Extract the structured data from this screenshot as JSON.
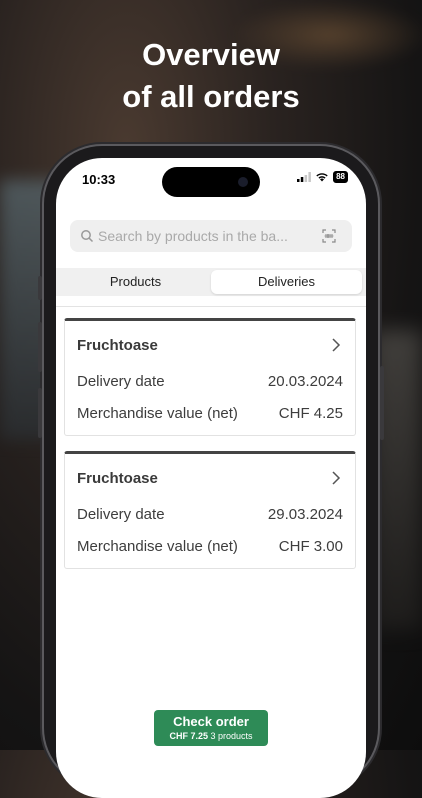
{
  "headline": {
    "line1": "Overview",
    "line2": "of all orders"
  },
  "status_bar": {
    "time": "10:33",
    "battery": "88"
  },
  "search": {
    "placeholder": "Search by products in the ba..."
  },
  "tabs": [
    {
      "label": "Products",
      "active": false
    },
    {
      "label": "Deliveries",
      "active": true
    }
  ],
  "orders": [
    {
      "supplier": "Fruchtoase",
      "delivery_label": "Delivery date",
      "delivery_date": "20.03.2024",
      "value_label": "Merchandise value (net)",
      "value": "CHF 4.25"
    },
    {
      "supplier": "Fruchtoase",
      "delivery_label": "Delivery date",
      "delivery_date": "29.03.2024",
      "value_label": "Merchandise value (net)",
      "value": "CHF 3.00"
    }
  ],
  "checkout": {
    "label": "Check order",
    "total": "CHF 7.25",
    "count": "3 products"
  },
  "colors": {
    "accent": "#2e8b57",
    "card_top_border": "#444444"
  },
  "icons": [
    "search-icon",
    "barcode-scan-icon",
    "chevron-right-icon",
    "signal-icon",
    "wifi-icon",
    "battery-icon"
  ]
}
